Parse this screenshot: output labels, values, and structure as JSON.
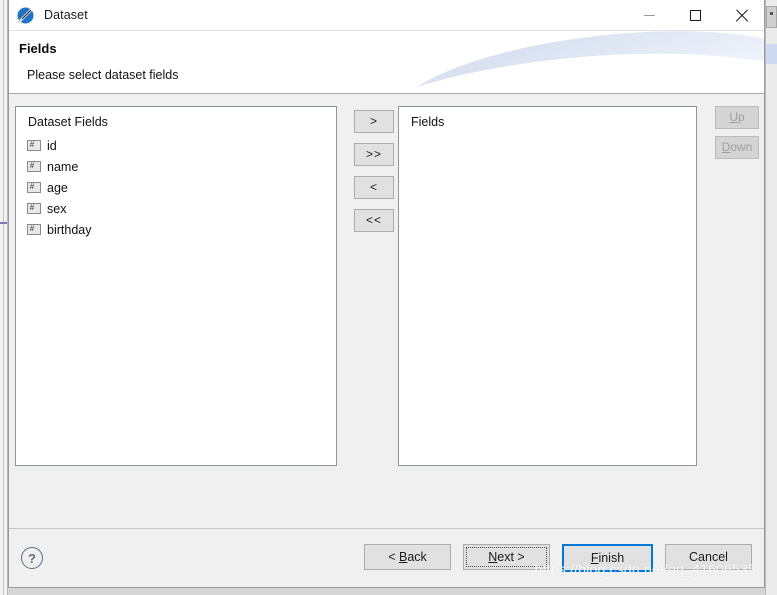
{
  "window": {
    "title": "Dataset",
    "app_icon": "dataset-icon",
    "controls": {
      "minimize": "minimize-icon",
      "maximize": "maximize-icon",
      "close": "close-icon"
    }
  },
  "header": {
    "title": "Fields",
    "subtitle": "Please select dataset fields"
  },
  "panels": {
    "left": {
      "label": "Dataset Fields",
      "items": [
        {
          "name": "id",
          "icon": "#"
        },
        {
          "name": "name",
          "icon": "#"
        },
        {
          "name": "age",
          "icon": "#"
        },
        {
          "name": "sex",
          "icon": "#"
        },
        {
          "name": "birthday",
          "icon": "#"
        }
      ]
    },
    "right": {
      "label": "Fields",
      "items": []
    }
  },
  "transfer_buttons": [
    {
      "label": ">",
      "name": "move-right-button"
    },
    {
      "label": ">>",
      "name": "move-all-right-button"
    },
    {
      "label": "<",
      "name": "move-left-button"
    },
    {
      "label": "<<",
      "name": "move-all-left-button"
    }
  ],
  "order_buttons": {
    "up": {
      "label": "Up",
      "mnemonic": "U",
      "enabled": false
    },
    "down": {
      "label": "Down",
      "mnemonic": "D",
      "enabled": false
    }
  },
  "footer": {
    "help": "?",
    "buttons": {
      "back": {
        "label": "< Back",
        "mnemonic": "B"
      },
      "next": {
        "label": "Next >",
        "mnemonic": "N"
      },
      "finish": {
        "label": "Finish",
        "mnemonic": "F"
      },
      "cancel": {
        "label": "Cancel",
        "mnemonic": ""
      }
    }
  },
  "watermark": "https://blog.csdn.net/qq_41606535",
  "colors": {
    "accent": "#0078d7",
    "dialog_bg": "#f0f0f0",
    "list_bg": "#ffffff",
    "button_bg": "#e1e1e1",
    "disabled_text": "#a0a0a0",
    "help_icon": "#5b6b80"
  }
}
